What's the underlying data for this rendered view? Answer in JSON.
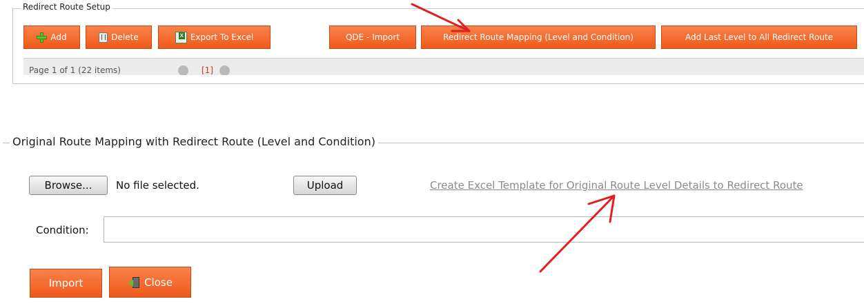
{
  "top_panel": {
    "legend": "Redirect Route Setup",
    "buttons": {
      "add": "Add",
      "delete": "Delete",
      "export": "Export To Excel",
      "qde_import": "QDE - Import",
      "redirect_mapping": "Redirect Route Mapping (Level and Condition)",
      "add_last_level": "Add Last Level to All Redirect Route"
    },
    "pager": {
      "text": "Page 1 of 1 (22 items)",
      "current_page": "[1]"
    }
  },
  "mapping_panel": {
    "legend": "Original Route Mapping with Redirect Route (Level and Condition)",
    "browse_label": "Browse...",
    "file_status": "No file selected.",
    "upload_label": "Upload",
    "template_link": "Create Excel Template for Original Route Level Details to Redirect Route",
    "condition_label": "Condition:",
    "condition_value": "",
    "import_label": "Import",
    "close_label": "Close"
  },
  "colors": {
    "button_orange": "#f26a2a",
    "annotation_arrow": "#e02020",
    "link_gray": "#8a8a8a"
  },
  "icons": {
    "add": "plus-icon",
    "delete": "trash-icon",
    "export": "excel-icon",
    "close": "exit-door-icon"
  }
}
